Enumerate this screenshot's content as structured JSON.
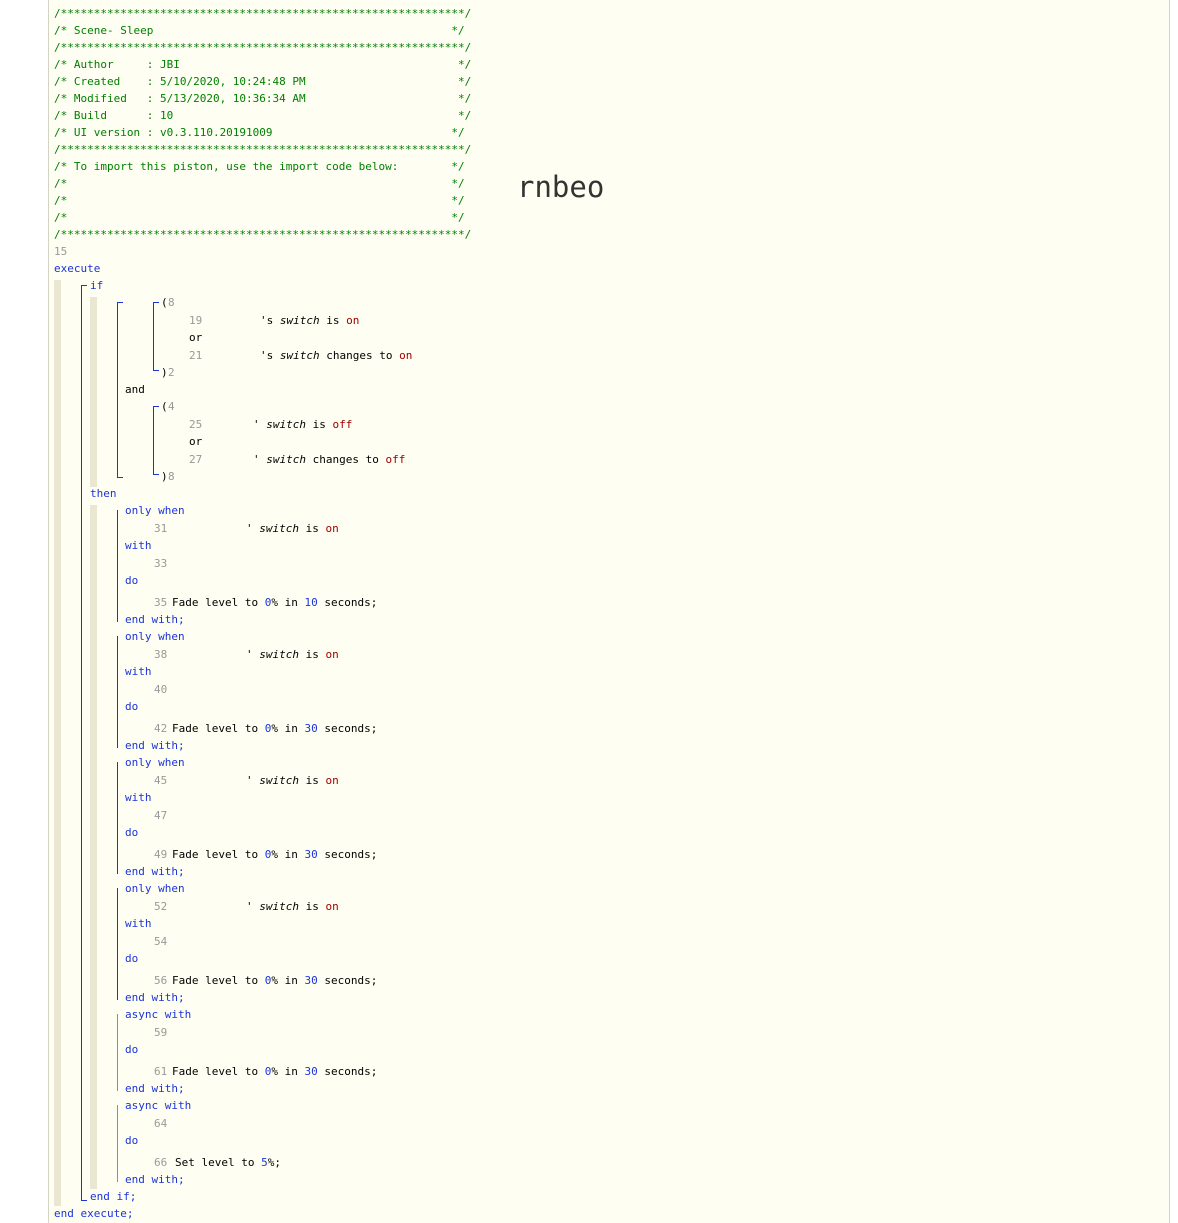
{
  "header": {
    "border": "/*************************************************************/",
    "title_line": "/* Scene- Sleep                                             */",
    "author_line": "/* Author     : JBI                                          */",
    "created_line": "/* Created    : 5/10/2020, 10:24:48 PM                       */",
    "modified_line": "/* Modified   : 5/13/2020, 10:36:34 AM                       */",
    "build_line": "/* Build      : 10                                           */",
    "ui_line": "/* UI version : v0.3.110.20191009                           */",
    "import_line": "/* To import this piston, use the import code below:        */",
    "empty_line": "/*                                                          */"
  },
  "overlay_text": "rnbeo",
  "line_numbers": {
    "l15": "15",
    "l18": "8",
    "l19": "19",
    "l21": "21",
    "l22": "2",
    "l24": "4",
    "l25": "25",
    "l27": "27",
    "l28": "8",
    "l31": "31",
    "l33": "33",
    "l35": "35",
    "l38": "38",
    "l40": "40",
    "l42": "42",
    "l45": "45",
    "l47": "47",
    "l49": "49",
    "l52": "52",
    "l54": "54",
    "l56": "56",
    "l59": "59",
    "l61": "61",
    "l64": "64",
    "l66": "66"
  },
  "keywords": {
    "execute": "execute",
    "if": "if",
    "open_paren": "(",
    "close_paren": ")",
    "or": "or",
    "and": "and",
    "then": "then",
    "only_when": "only when",
    "with": "with",
    "do": "do",
    "end_with": "end with;",
    "async_with": "async with",
    "end_if": "end if;",
    "end_execute": "end execute;"
  },
  "conditions": {
    "c19": {
      "prefix": "'s ",
      "attr": "switch",
      "op": " is ",
      "val": "on"
    },
    "c21": {
      "prefix": "'s ",
      "attr": "switch",
      "op": " changes to ",
      "val": "on"
    },
    "c25": {
      "prefix": "' ",
      "attr": "switch",
      "op": " is ",
      "val": "off"
    },
    "c27": {
      "prefix": "' ",
      "attr": "switch",
      "op": " changes to ",
      "val": "off"
    },
    "c31": {
      "prefix": "' ",
      "attr": "switch",
      "op": " is ",
      "val": "on"
    },
    "c38": {
      "prefix": "' ",
      "attr": "switch",
      "op": " is ",
      "val": "on"
    },
    "c45": {
      "prefix": "' ",
      "attr": "switch",
      "op": " is ",
      "val": "on"
    },
    "c52": {
      "prefix": "' ",
      "attr": "switch",
      "op": " is ",
      "val": "on"
    }
  },
  "actions": {
    "fade_prefix": "Fade level to ",
    "fade_value": "0",
    "percent": "%",
    "in": " in ",
    "seconds": " seconds;",
    "a35_dur": "10",
    "a42_dur": "30",
    "a49_dur": "30",
    "a56_dur": "30",
    "a61_dur": "30",
    "set_prefix": "Set level to ",
    "set_value": "5",
    "set_suffix": "%;"
  },
  "colors": {
    "comment": "#008000",
    "keyword": "#1b34d9",
    "value": "#a10000",
    "number": "#999999",
    "background": "#fefef2"
  }
}
